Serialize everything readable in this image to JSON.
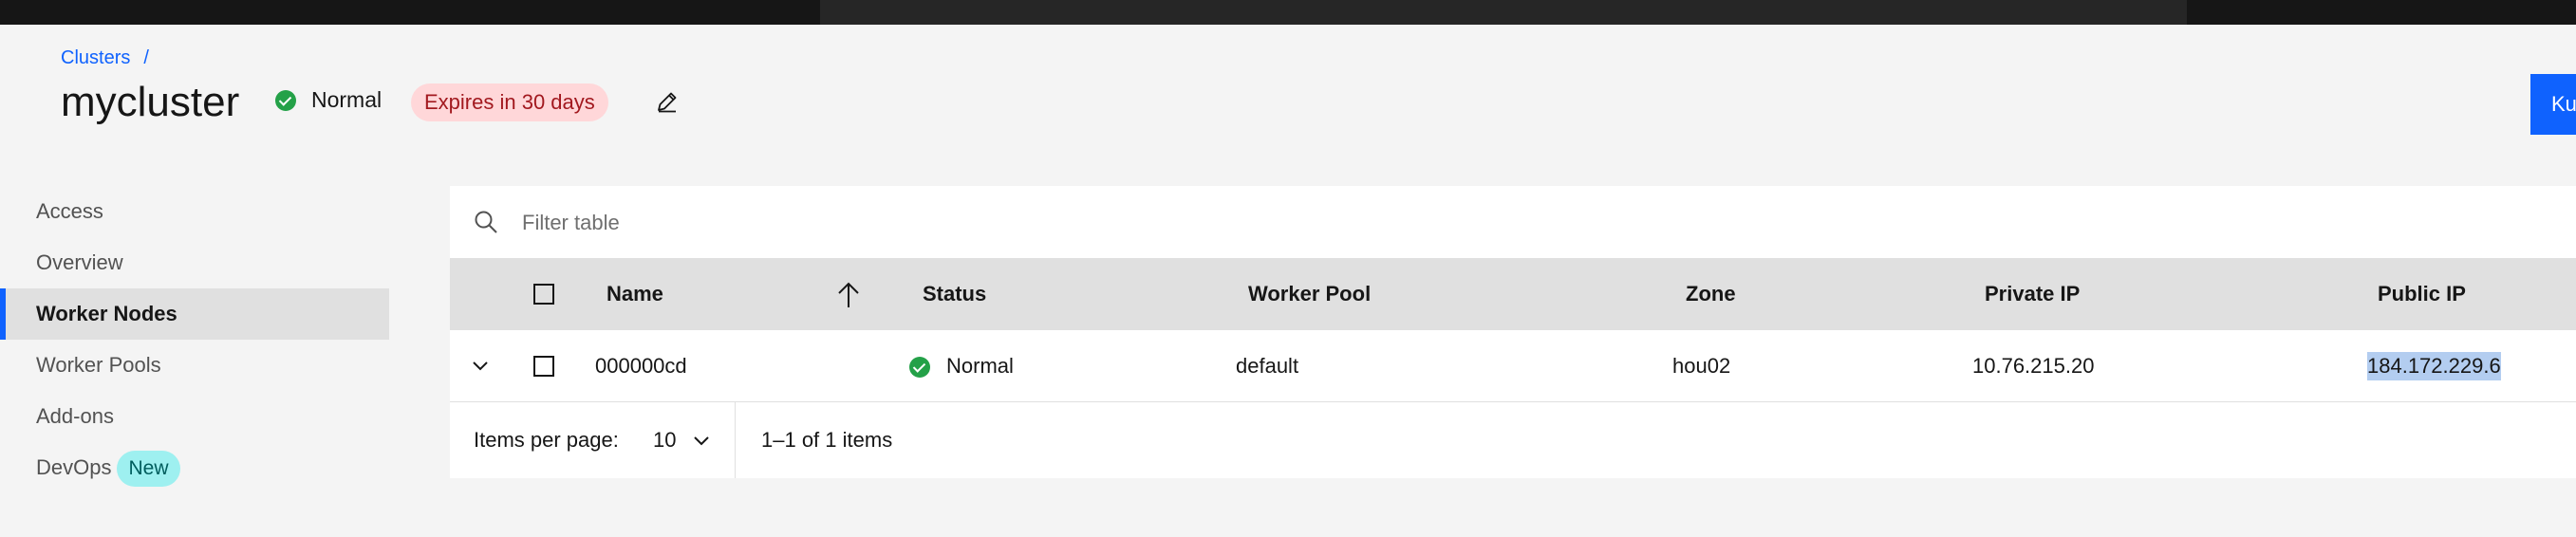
{
  "breadcrumb": {
    "link": "Clusters",
    "separator": "/"
  },
  "header": {
    "title": "mycluster",
    "status": "Normal",
    "expires_tag": "Expires in 30 days",
    "action_button": "Ku"
  },
  "sidebar": {
    "items": [
      {
        "label": "Access"
      },
      {
        "label": "Overview"
      },
      {
        "label": "Worker Nodes"
      },
      {
        "label": "Worker Pools"
      },
      {
        "label": "Add-ons"
      },
      {
        "label": "DevOps",
        "tag": "New"
      }
    ],
    "active_index": 2
  },
  "table": {
    "filter_placeholder": "Filter table",
    "columns": [
      "Name",
      "Status",
      "Worker Pool",
      "Zone",
      "Private IP",
      "Public IP"
    ],
    "sort_column": "Name",
    "sort_direction": "ascending",
    "rows": [
      {
        "name": "000000cd",
        "status": "Normal",
        "worker_pool": "default",
        "zone": "hou02",
        "private_ip": "10.76.215.20",
        "public_ip": "184.172.229.6"
      }
    ],
    "pagination": {
      "items_per_page_label": "Items per page:",
      "items_per_page": "10",
      "range": "1–1 of 1 items"
    }
  },
  "colors": {
    "accent": "#0f62fe",
    "status_ok": "#24a148",
    "expires_tag_bg": "#ffd7d9",
    "expires_tag_text": "#a2191f",
    "new_tag_bg": "#9ef0f0",
    "selection_highlight": "#b3cdf0"
  },
  "icons": {
    "status": "checkmark-filled-icon",
    "edit": "edit-pencil-icon",
    "search": "search-icon",
    "sort": "arrow-up-icon",
    "expand": "chevron-down-icon",
    "select": "chevron-down-icon"
  }
}
